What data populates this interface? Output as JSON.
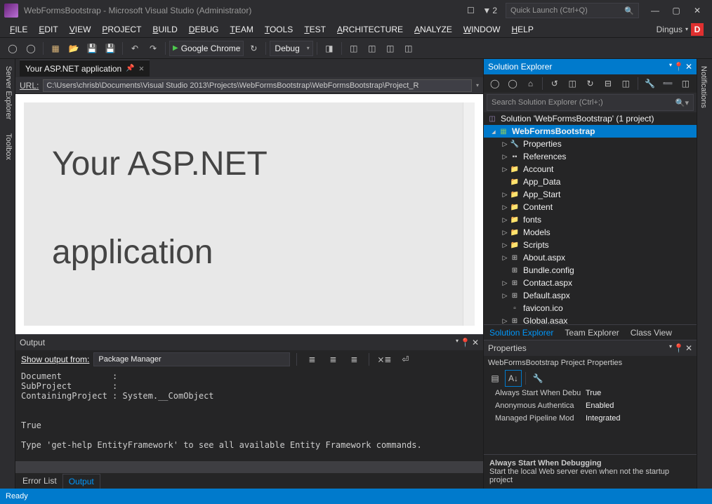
{
  "titlebar": {
    "title": "WebFormsBootstrap - Microsoft Visual Studio (Administrator)",
    "flag_count": "2",
    "quick_launch_placeholder": "Quick Launch (Ctrl+Q)"
  },
  "menubar": {
    "items": [
      "FILE",
      "EDIT",
      "VIEW",
      "PROJECT",
      "BUILD",
      "DEBUG",
      "TEAM",
      "TOOLS",
      "TEST",
      "ARCHITECTURE",
      "ANALYZE",
      "WINDOW",
      "HELP"
    ],
    "user": "Dingus",
    "user_initial": "D"
  },
  "toolbar": {
    "browser": "Google Chrome",
    "config": "Debug"
  },
  "left_tabs": [
    "Server Explorer",
    "Toolbox"
  ],
  "right_tab": "Notifications",
  "doc": {
    "tab_title": "Your ASP.NET application",
    "url_label": "URL:",
    "url": "C:\\Users\\chrisb\\Documents\\Visual Studio 2013\\Projects\\WebFormsBootstrap\\WebFormsBootstrap\\Project_R",
    "heading_line1": "Your ASP.NET",
    "heading_line2": "application"
  },
  "output": {
    "title": "Output",
    "from_label": "Show output from:",
    "from_value": "Package Manager",
    "text": "Document          :\nSubProject        :\nContainingProject : System.__ComObject\n\n\nTrue\n\nType 'get-help EntityFramework' to see all available Entity Framework commands.",
    "bottom_tabs": [
      "Error List",
      "Output"
    ]
  },
  "solution_explorer": {
    "title": "Solution Explorer",
    "search_placeholder": "Search Solution Explorer (Ctrl+;)",
    "solution": "Solution 'WebFormsBootstrap' (1 project)",
    "project": "WebFormsBootstrap",
    "nodes": [
      {
        "label": "Properties",
        "icon": "wrench",
        "expandable": true
      },
      {
        "label": "References",
        "icon": "ref",
        "expandable": true
      },
      {
        "label": "Account",
        "icon": "folder",
        "expandable": true
      },
      {
        "label": "App_Data",
        "icon": "folder",
        "expandable": false
      },
      {
        "label": "App_Start",
        "icon": "folder",
        "expandable": true
      },
      {
        "label": "Content",
        "icon": "folder",
        "expandable": true
      },
      {
        "label": "fonts",
        "icon": "folder",
        "expandable": true
      },
      {
        "label": "Models",
        "icon": "folder",
        "expandable": true
      },
      {
        "label": "Scripts",
        "icon": "folder",
        "expandable": true
      },
      {
        "label": "About.aspx",
        "icon": "aspx",
        "expandable": true
      },
      {
        "label": "Bundle.config",
        "icon": "config",
        "expandable": false
      },
      {
        "label": "Contact.aspx",
        "icon": "aspx",
        "expandable": true
      },
      {
        "label": "Default.aspx",
        "icon": "aspx",
        "expandable": true
      },
      {
        "label": "favicon.ico",
        "icon": "file",
        "expandable": false
      },
      {
        "label": "Global.asax",
        "icon": "aspx",
        "expandable": true
      }
    ],
    "bottom_tabs": [
      "Solution Explorer",
      "Team Explorer",
      "Class View"
    ]
  },
  "properties": {
    "title": "Properties",
    "header": "WebFormsBootstrap Project Properties",
    "rows": [
      {
        "name": "Always Start When Debu",
        "value": "True"
      },
      {
        "name": "Anonymous Authentica",
        "value": "Enabled"
      },
      {
        "name": "Managed Pipeline Mod",
        "value": "Integrated"
      }
    ],
    "desc_title": "Always Start When Debugging",
    "desc_text": "Start the local Web server even when not the startup project"
  },
  "statusbar": {
    "text": "Ready"
  }
}
